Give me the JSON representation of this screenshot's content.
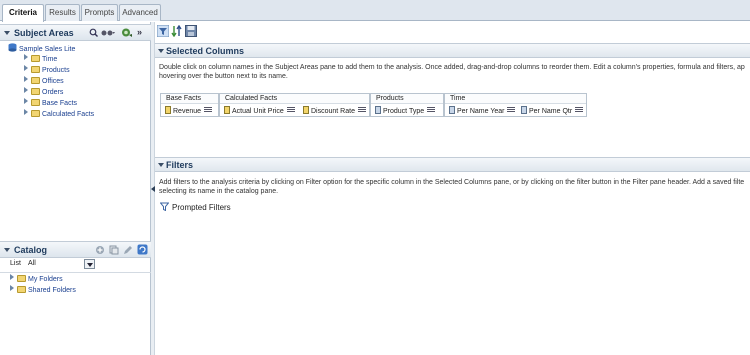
{
  "tabs": [
    {
      "label": "Criteria",
      "active": true
    },
    {
      "label": "Results",
      "active": false
    },
    {
      "label": "Prompts",
      "active": false
    },
    {
      "label": "Advanced",
      "active": false
    }
  ],
  "subject_areas": {
    "title": "Subject Areas",
    "root": "Sample Sales Lite",
    "items": [
      "Time",
      "Products",
      "Offices",
      "Orders",
      "Base Facts",
      "Calculated Facts"
    ]
  },
  "catalog": {
    "title": "Catalog",
    "list_label": "List",
    "list_value": "All",
    "items": [
      "My Folders",
      "Shared Folders"
    ]
  },
  "selected_columns": {
    "title": "Selected Columns",
    "desc_line1": "Double click on column names in the Subject Areas pane to add them to the analysis. Once added, drag-and-drop columns to reorder them. Edit a column's properties, formula and filters, ap",
    "desc_line2": "hovering over the button next to its name.",
    "groups": [
      {
        "name": "Base Facts",
        "columns": [
          "Revenue"
        ]
      },
      {
        "name": "Calculated Facts",
        "columns": [
          "Actual Unit Price",
          "Discount Rate"
        ]
      },
      {
        "name": "Products",
        "columns": [
          "Product Type"
        ]
      },
      {
        "name": "Time",
        "columns": [
          "Per Name Year",
          "Per Name Qtr"
        ]
      }
    ]
  },
  "filters": {
    "title": "Filters",
    "desc_line1": "Add filters to the analysis criteria by clicking on Filter option for the specific column in the Selected Columns pane, or by clicking on the filter button in the Filter pane header. Add a saved filte",
    "desc_line2": "selecting its name in the catalog pane.",
    "prompted_label": "Prompted Filters"
  },
  "colors": {
    "accent": "#1e3a5c",
    "link": "#1a3f8f",
    "folder": "#f2d572"
  }
}
